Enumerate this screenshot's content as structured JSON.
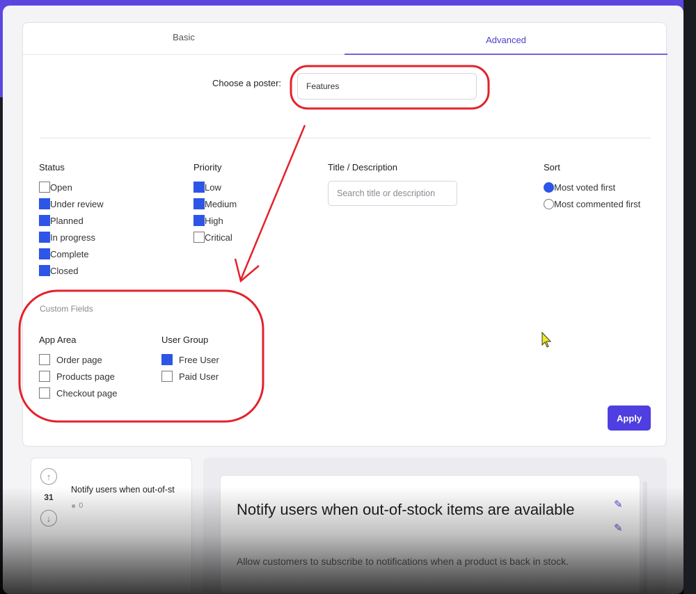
{
  "tabs": {
    "basic": "Basic",
    "advanced": "Advanced",
    "active": "Advanced"
  },
  "poster": {
    "label": "Choose a poster:",
    "value": "Features"
  },
  "status": {
    "title": "Status",
    "items": [
      {
        "label": "Open",
        "checked": false
      },
      {
        "label": "Under review",
        "checked": true
      },
      {
        "label": "Planned",
        "checked": true
      },
      {
        "label": "In progress",
        "checked": true
      },
      {
        "label": "Complete",
        "checked": true
      },
      {
        "label": "Closed",
        "checked": true
      }
    ]
  },
  "priority": {
    "title": "Priority",
    "items": [
      {
        "label": "Low",
        "checked": true
      },
      {
        "label": "Medium",
        "checked": true
      },
      {
        "label": "High",
        "checked": true
      },
      {
        "label": "Critical",
        "checked": false
      }
    ]
  },
  "title_description": {
    "title": "Title / Description",
    "placeholder": "Search title or description"
  },
  "sort": {
    "title": "Sort",
    "options": [
      {
        "label": "Most voted first",
        "selected": true
      },
      {
        "label": "Most commented first",
        "selected": false
      }
    ]
  },
  "custom_fields": {
    "title": "Custom Fields",
    "app_area": {
      "title": "App Area",
      "items": [
        {
          "label": "Order page",
          "checked": false
        },
        {
          "label": "Products page",
          "checked": false
        },
        {
          "label": "Checkout page",
          "checked": false
        }
      ]
    },
    "user_group": {
      "title": "User Group",
      "items": [
        {
          "label": "Free User",
          "checked": true
        },
        {
          "label": "Paid User",
          "checked": false
        }
      ]
    }
  },
  "apply_label": "Apply",
  "post_list": [
    {
      "votes": "31",
      "title": "Notify users when out-of-st",
      "comments": "0"
    }
  ],
  "post_detail": {
    "title": "Notify users when out-of-stock items are available",
    "description": "Allow customers to subscribe to notifications when a product is back in stock."
  },
  "colors": {
    "accent": "#4f3ee0",
    "checkbox": "#2d55e6",
    "annotation": "#e4212b"
  },
  "icons": {
    "vote_up": "arrow-up-circle-icon",
    "vote_down": "arrow-down-circle-icon",
    "comment": "comment-icon",
    "edit": "pencil-icon",
    "cursor": "mouse-pointer-icon"
  }
}
